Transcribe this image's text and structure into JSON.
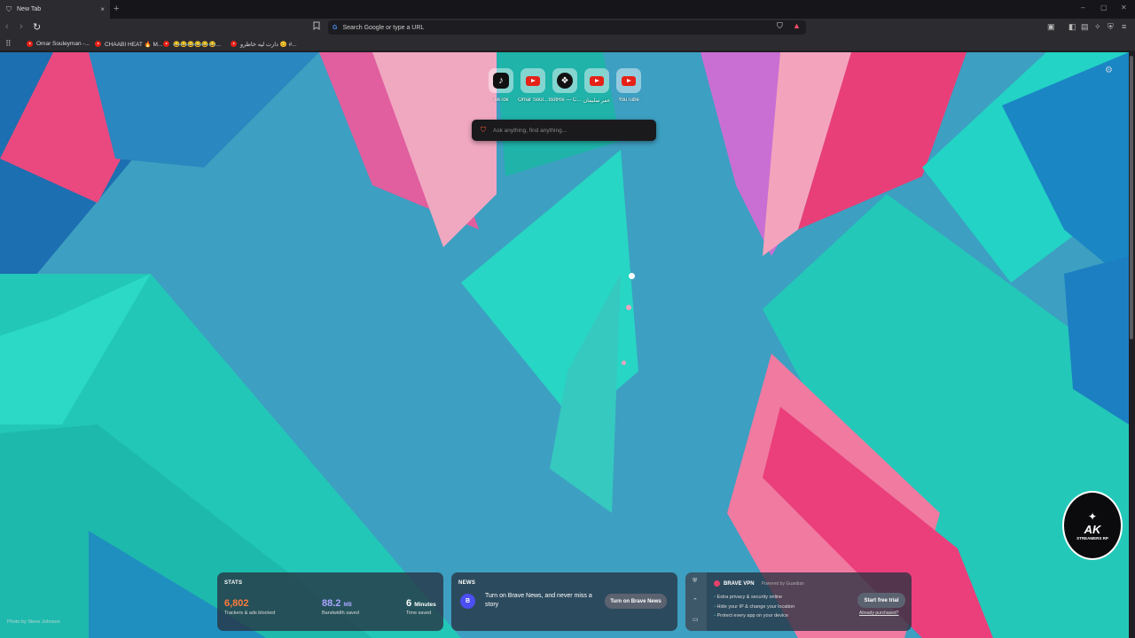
{
  "tab": {
    "title": "New Tab",
    "close": "×",
    "new_tab": "+"
  },
  "window": {
    "minimize": "–",
    "maximize": "▢",
    "close": "✕"
  },
  "toolbar": {
    "back": "‹",
    "forward": "›",
    "reload": "↻",
    "address_placeholder": "Search Google or type a URL",
    "google_glyph": "G"
  },
  "bookmarks_bar": {
    "apps_glyph": "⠿",
    "items": [
      {
        "label": "Omar Souleyman -..."
      },
      {
        "label": "CHAABI HEAT 🔥 M..."
      },
      {
        "label": "😂😂😂😂😂😂..."
      },
      {
        "label": "دارت ليه خاطرو 😊 #..."
      }
    ]
  },
  "top_sites": [
    {
      "label": "TikTok",
      "icon": "tiktok-icon",
      "glyph": "♪"
    },
    {
      "label": "Omar Soul...",
      "icon": "youtube-icon"
    },
    {
      "label": "BotRix — C...",
      "icon": "botrix-icon",
      "glyph": "❖"
    },
    {
      "label": "عمر سليمان",
      "icon": "youtube-icon"
    },
    {
      "label": "YouTube",
      "icon": "youtube-icon"
    }
  ],
  "search": {
    "placeholder": "Ask anything, find anything..."
  },
  "photo_credit": "Photo by Steve Johnson",
  "stats": {
    "heading": "STATS",
    "trackers": {
      "value": "6,802",
      "label": "Trackers & ads blocked",
      "color": "#ff7b3d"
    },
    "bandwidth": {
      "value": "88.2",
      "unit": "MB",
      "label": "Bandwidth saved",
      "color": "#a8a5ff"
    },
    "time": {
      "value": "6",
      "unit": "Minutes",
      "label": "Time saved"
    }
  },
  "news": {
    "heading": "NEWS",
    "text": "Turn on Brave News, and never miss a story",
    "button": "Turn on Brave News",
    "glyph": "B"
  },
  "vpn": {
    "heading": "BRAVE VPN",
    "powered": "Powered by Guardian",
    "features": [
      "Extra privacy & security online",
      "Hide your IP & change your location",
      "Protect every app on your device"
    ],
    "button": "Start free trial",
    "link": "Already purchased?"
  },
  "overlay_logo": {
    "text": "AK",
    "sub": "STREAMERS RP"
  },
  "colors": {
    "accent_orange": "#ff7b3d",
    "accent_purple": "#a8a5ff",
    "youtube_red": "#e62117"
  }
}
